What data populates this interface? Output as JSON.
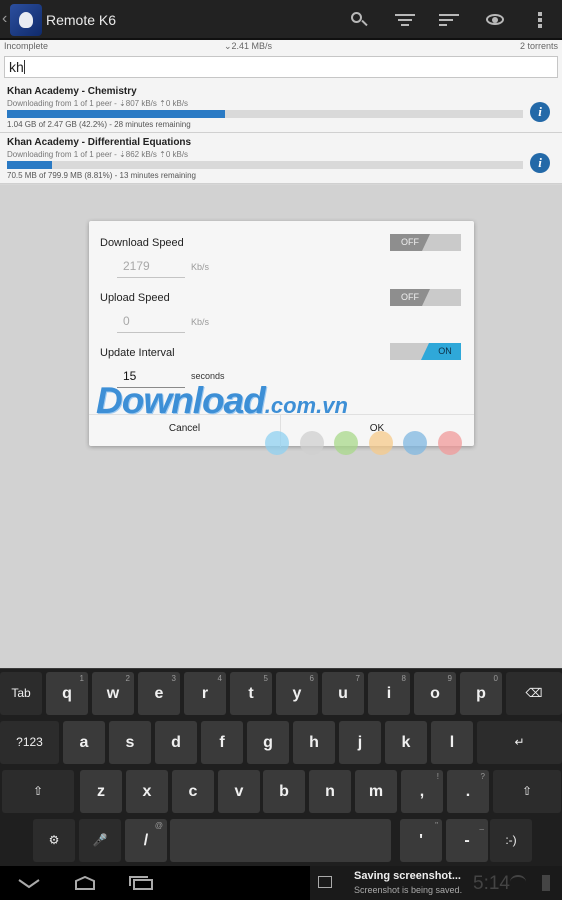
{
  "app": {
    "title": "Remote K6"
  },
  "icons": {
    "back": "chevron-left-icon",
    "logo": "app-logo",
    "toolbar": [
      "search-icon",
      "filter-icon",
      "sort-icon",
      "eye-icon",
      "overflow-menu-icon"
    ]
  },
  "status_strip": {
    "filter": "Incomplete",
    "speed": "⌄2.41 MB/s",
    "count": "2 torrents"
  },
  "search": {
    "value": "kh"
  },
  "torrents": [
    {
      "name": "Khan Academy - Chemistry",
      "status": "Downloading from 1 of 1 peer - ⇣807 kB/s ⇡0 kB/s",
      "progress": 0.422,
      "meta": "1.04 GB of 2.47 GB (42.2%) - 28 minutes remaining",
      "info_label": "i"
    },
    {
      "name": "Khan Academy - Differential Equations",
      "status": "Downloading from 1 of 1 peer - ⇣862 kB/s ⇡0 kB/s",
      "progress": 0.0881,
      "meta": "70.5 MB of 799.9 MB (8.81%) - 13 minutes remaining",
      "info_label": "i"
    }
  ],
  "dialog": {
    "download": {
      "label": "Download Speed",
      "toggle": "OFF",
      "value": "2179",
      "unit": "Kb/s"
    },
    "upload": {
      "label": "Upload Speed",
      "toggle": "OFF",
      "value": "0",
      "unit": "Kb/s"
    },
    "interval": {
      "label": "Update Interval",
      "toggle": "ON",
      "value": "15",
      "unit": "seconds"
    },
    "cancel_label": "Cancel",
    "ok_label": "OK"
  },
  "watermark": {
    "big": "Download",
    "small": ".com.vn"
  },
  "watermark_dots": [
    "#8fd0f0",
    "#cfcfcf",
    "#a8d88a",
    "#f5c98a",
    "#7fb7e0",
    "#f09a9a"
  ],
  "keyboard": {
    "row1": [
      {
        "label": "Tab",
        "sup": ""
      },
      {
        "label": "q",
        "sup": "1"
      },
      {
        "label": "w",
        "sup": "2"
      },
      {
        "label": "e",
        "sup": "3"
      },
      {
        "label": "r",
        "sup": "4"
      },
      {
        "label": "t",
        "sup": "5"
      },
      {
        "label": "y",
        "sup": "6"
      },
      {
        "label": "u",
        "sup": "7"
      },
      {
        "label": "i",
        "sup": "8"
      },
      {
        "label": "o",
        "sup": "9"
      },
      {
        "label": "p",
        "sup": "0"
      },
      {
        "label": "⌫",
        "sup": ""
      }
    ],
    "row2": [
      {
        "label": "?123",
        "sup": ""
      },
      {
        "label": "a",
        "sup": ""
      },
      {
        "label": "s",
        "sup": ""
      },
      {
        "label": "d",
        "sup": ""
      },
      {
        "label": "f",
        "sup": ""
      },
      {
        "label": "g",
        "sup": ""
      },
      {
        "label": "h",
        "sup": ""
      },
      {
        "label": "j",
        "sup": ""
      },
      {
        "label": "k",
        "sup": ""
      },
      {
        "label": "l",
        "sup": ""
      },
      {
        "label": "↵",
        "sup": ""
      }
    ],
    "row3": [
      {
        "label": "⇧",
        "sup": ""
      },
      {
        "label": "z",
        "sup": ""
      },
      {
        "label": "x",
        "sup": ""
      },
      {
        "label": "c",
        "sup": ""
      },
      {
        "label": "v",
        "sup": ""
      },
      {
        "label": "b",
        "sup": ""
      },
      {
        "label": "n",
        "sup": ""
      },
      {
        "label": "m",
        "sup": ""
      },
      {
        "label": ",",
        "sup": "!"
      },
      {
        "label": ".",
        "sup": "?"
      },
      {
        "label": "⇧",
        "sup": ""
      }
    ],
    "row4": [
      {
        "label": "⚙",
        "sup": ""
      },
      {
        "label": "🎤",
        "sup": ""
      },
      {
        "label": "/",
        "sup": "@"
      },
      {
        "label": "",
        "sup": ""
      },
      {
        "label": "'",
        "sup": "\""
      },
      {
        "label": "-",
        "sup": "_"
      },
      {
        "label": ":-)",
        "sup": ""
      }
    ]
  },
  "notification": {
    "title": "Saving screenshot...",
    "subtitle": "Screenshot is being saved.",
    "clock": "5:14"
  },
  "navbar": [
    "back-nav-icon",
    "home-nav-icon",
    "recents-nav-icon"
  ]
}
